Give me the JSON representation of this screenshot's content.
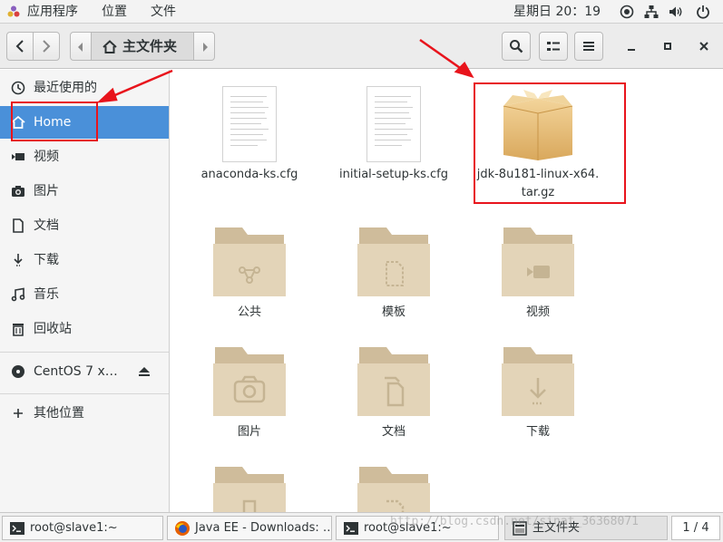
{
  "topbar": {
    "apps_label": "应用程序",
    "places_label": "位置",
    "file_label": "文件",
    "clock": "星期日 20：19"
  },
  "header": {
    "path_current": "主文件夹"
  },
  "sidebar": {
    "items": [
      {
        "label": "最近使用的",
        "icon": "clock-icon"
      },
      {
        "label": "Home",
        "icon": "home-icon"
      },
      {
        "label": "视频",
        "icon": "video-icon"
      },
      {
        "label": "图片",
        "icon": "camera-icon"
      },
      {
        "label": "文档",
        "icon": "document-icon"
      },
      {
        "label": "下载",
        "icon": "download-icon"
      },
      {
        "label": "音乐",
        "icon": "music-icon"
      },
      {
        "label": "回收站",
        "icon": "trash-icon"
      },
      {
        "label": "CentOS 7 x…",
        "icon": "disc-icon"
      },
      {
        "label": "其他位置",
        "icon": "plus-icon"
      }
    ]
  },
  "files": [
    {
      "name": "anaconda-ks.cfg",
      "type": "text-file"
    },
    {
      "name": "initial-setup-ks.cfg",
      "type": "text-file"
    },
    {
      "name_line1": "jdk-8u181-linux-x64.",
      "name_line2": "tar.gz",
      "type": "archive"
    },
    {
      "name": "公共",
      "type": "folder",
      "emblem": "share-icon"
    },
    {
      "name": "模板",
      "type": "folder",
      "emblem": "template-icon"
    },
    {
      "name": "视频",
      "type": "folder",
      "emblem": "video-icon"
    },
    {
      "name": "图片",
      "type": "folder",
      "emblem": "camera-icon"
    },
    {
      "name": "文档",
      "type": "folder",
      "emblem": "document-icon"
    },
    {
      "name": "下载",
      "type": "folder",
      "emblem": "download-icon"
    }
  ],
  "taskbar": {
    "tasks": [
      {
        "label": "root@slave1:~",
        "icon": "terminal-icon"
      },
      {
        "label": "Java EE - Downloads: …",
        "icon": "firefox-icon"
      },
      {
        "label": "root@slave1:~",
        "icon": "terminal-icon"
      },
      {
        "label": "主文件夹",
        "icon": "files-icon"
      }
    ],
    "pager": "1 / 4"
  },
  "watermark": "http://blog.csdn.net/sinat_36368071",
  "colors": {
    "selection": "#4a90d9",
    "annotation": "#e8141c",
    "folder": "#e0d0b4"
  }
}
